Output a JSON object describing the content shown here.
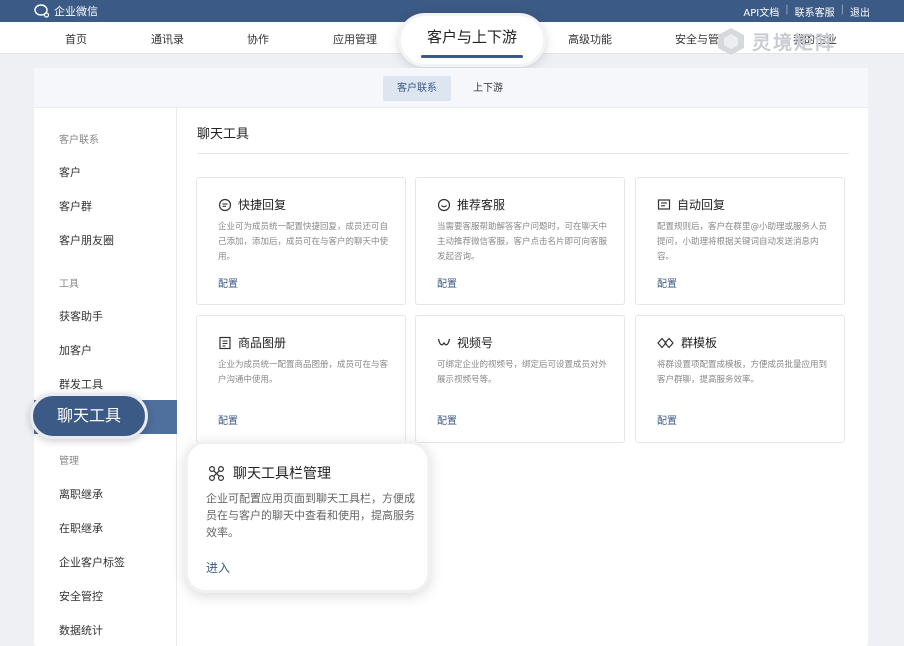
{
  "topbar": {
    "brand": "企业微信",
    "links": [
      "API文档",
      "联系客服",
      "退出"
    ]
  },
  "nav": {
    "items": [
      "首页",
      "通讯录",
      "协作",
      "应用管理",
      "高级功能",
      "安全与管理",
      "我的企业"
    ],
    "active": "客户与上下游"
  },
  "watermark": "灵境矩阵",
  "subtabs": [
    "客户联系",
    "上下游"
  ],
  "sidebar": {
    "group1": "客户联系",
    "group1_items": [
      "客户",
      "客户群",
      "客户朋友圈"
    ],
    "group2": "工具",
    "group2_items": [
      "获客助手",
      "加客户",
      "群发工具"
    ],
    "active": "聊天工具",
    "group3": "管理",
    "group3_items": [
      "离职继承",
      "在职继承",
      "企业客户标签",
      "安全管控",
      "数据统计"
    ]
  },
  "content": {
    "title": "聊天工具",
    "cards": [
      {
        "title": "快捷回复",
        "icon": "quick-reply-icon",
        "desc": "企业可为成员统一配置快捷回复，成员还可自己添加，添加后，成员可在与客户的聊天中使用。",
        "action": "配置"
      },
      {
        "title": "推荐客服",
        "icon": "customer-service-icon",
        "desc": "当需要客服帮助解答客户问题时，可在聊天中主动推荐微信客服，客户点击名片即可向客服发起咨询。",
        "action": "配置"
      },
      {
        "title": "自动回复",
        "icon": "auto-reply-icon",
        "desc": "配置规则后，客户在群里@小助理或服务人员提问，小助理将根据关键词自动发送消息内容。",
        "action": "配置"
      },
      {
        "title": "商品图册",
        "icon": "product-catalog-icon",
        "desc": "企业为成员统一配置商品图册，成员可在与客户沟通中使用。",
        "action": "配置"
      },
      {
        "title": "视频号",
        "icon": "channels-icon",
        "desc": "可绑定企业的视频号，绑定后可设置成员对外展示视频号等。",
        "action": "配置"
      },
      {
        "title": "群模板",
        "icon": "group-template-icon",
        "desc": "将群设置项配置成模板，方便成员批量应用到客户群聊，提高服务效率。",
        "action": "配置"
      }
    ],
    "featured": {
      "title": "聊天工具栏管理",
      "icon": "toolbar-manage-icon",
      "desc": "企业可配置应用页面到聊天工具栏，方便成员在与客户的聊天中查看和使用，提高服务效率。",
      "action": "进入"
    }
  }
}
